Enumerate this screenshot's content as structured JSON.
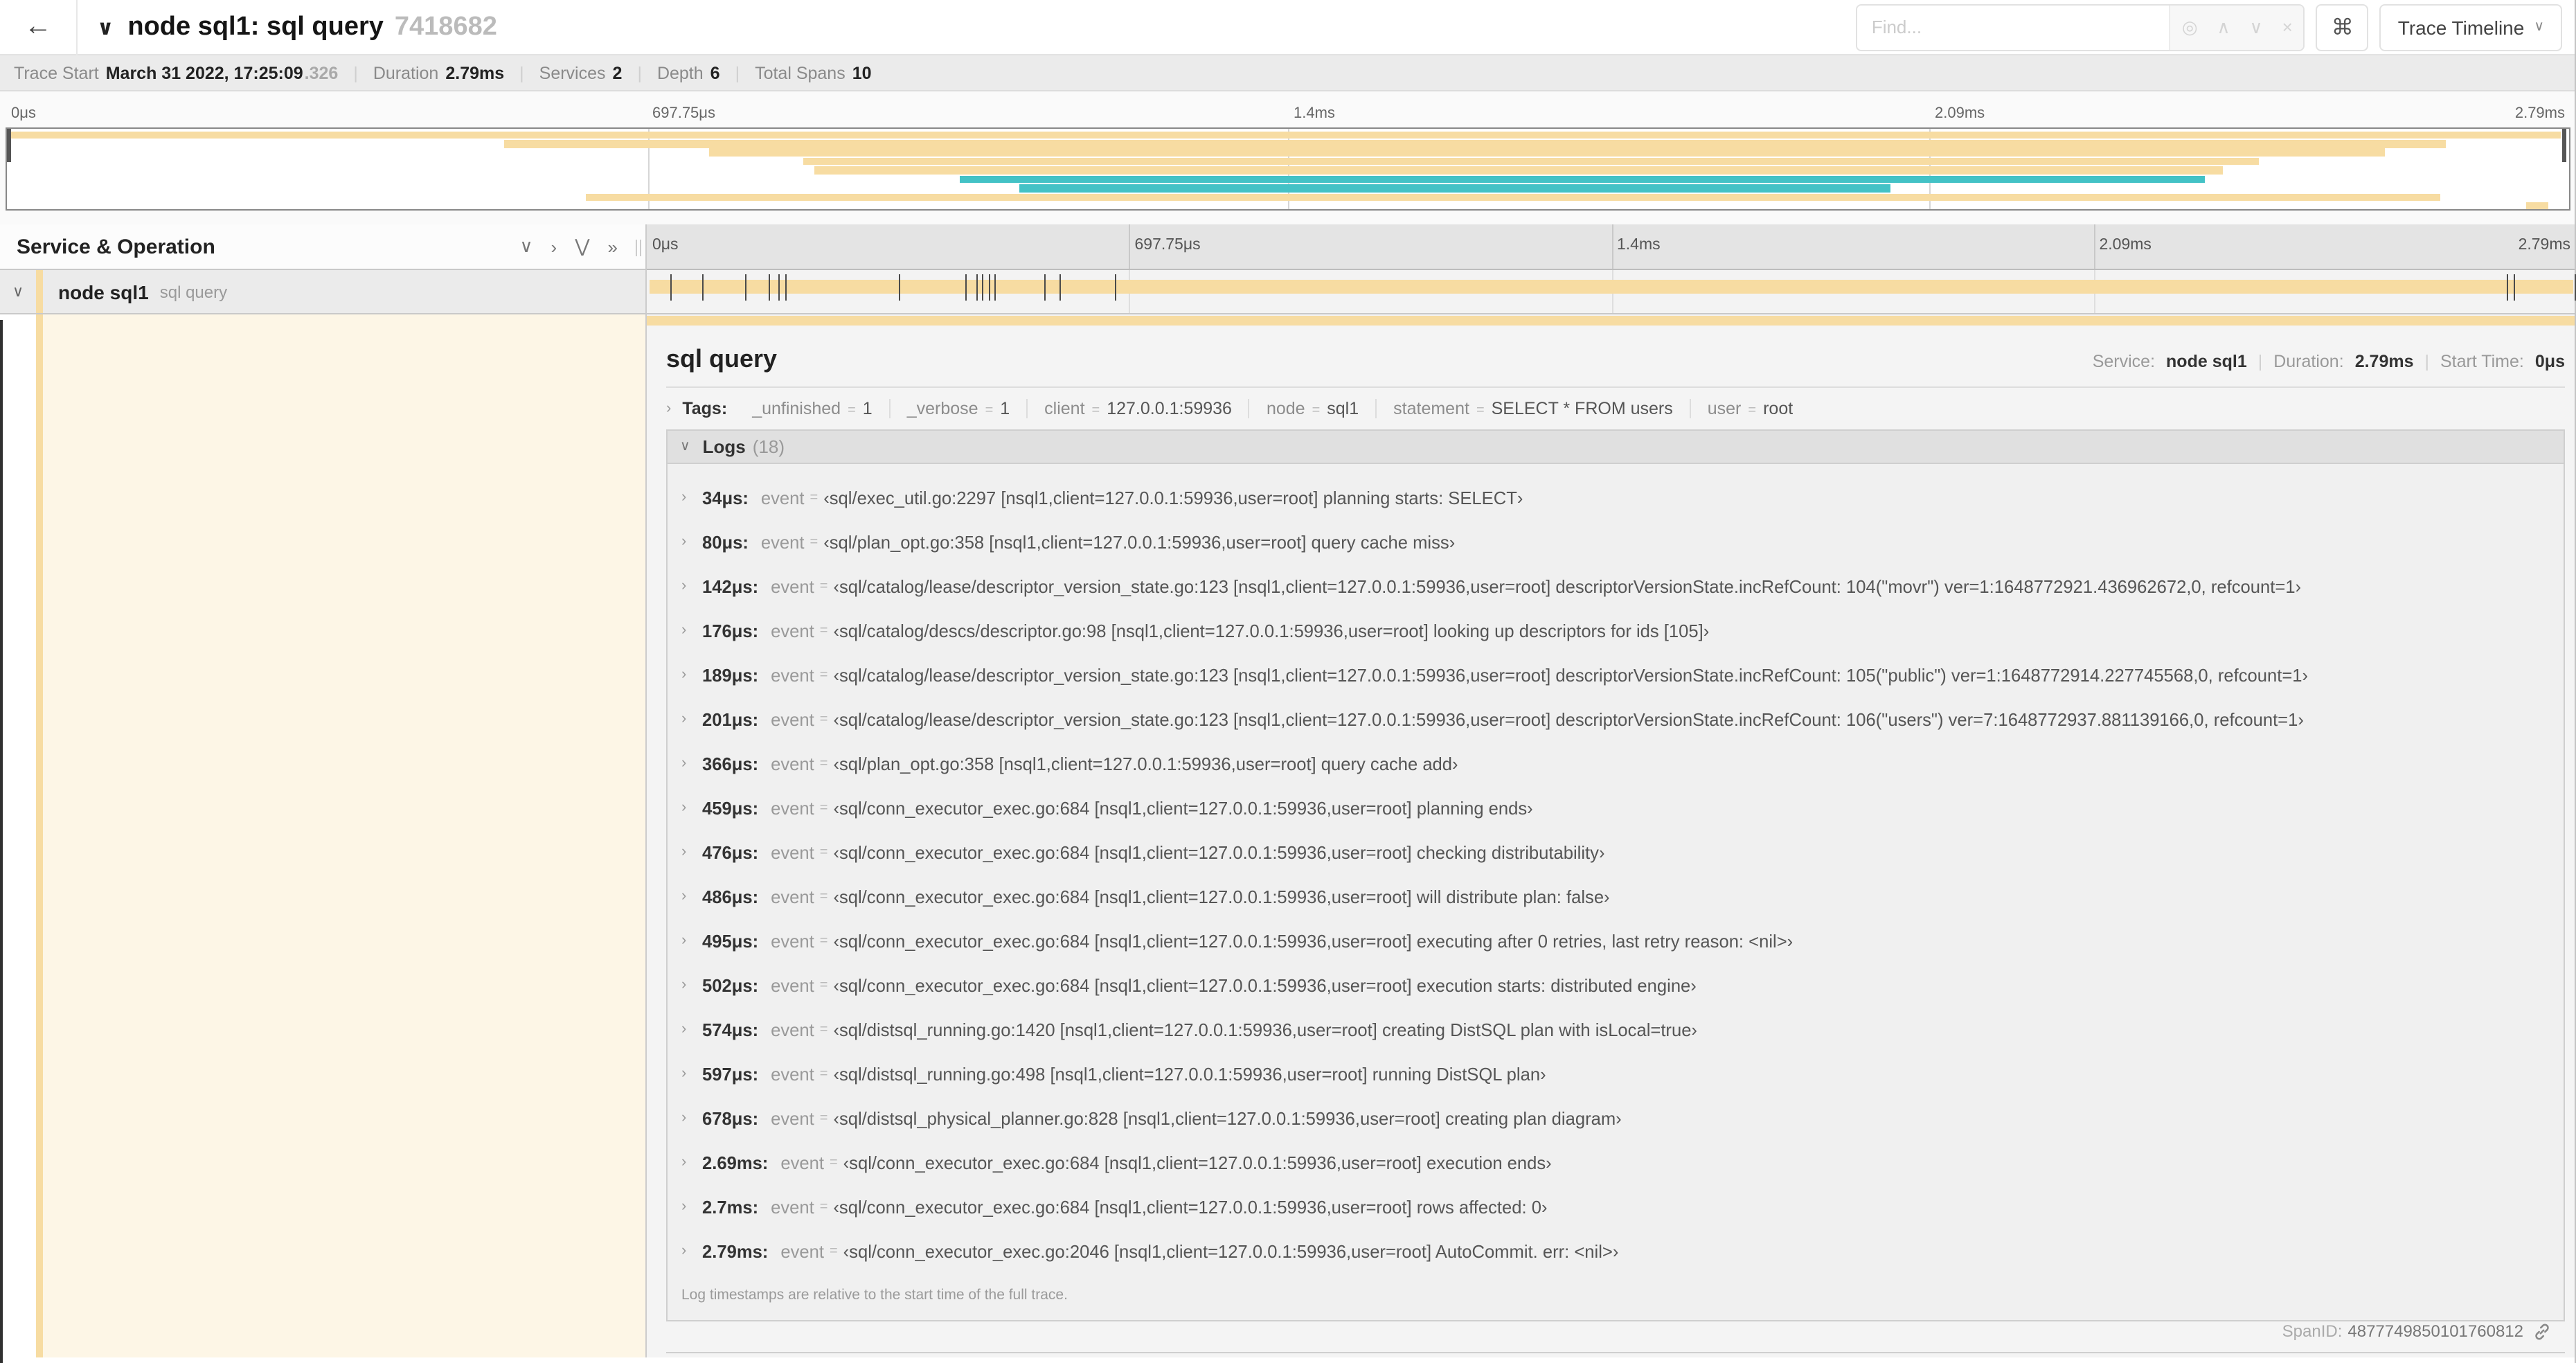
{
  "colors": {
    "orange": "#f7dca2",
    "teal": "#43c2c6",
    "cream": "#fdf6e6"
  },
  "header": {
    "back_icon": "←",
    "collapse_icon": "∨",
    "title": "node sql1: sql query",
    "trace_id_short": "7418682",
    "find_placeholder": "Find...",
    "find_tools": {
      "scope": "◎",
      "prev": "∧",
      "next": "∨",
      "clear": "×"
    },
    "shortcut_icon": "⌘",
    "view_select_label": "Trace Timeline",
    "view_select_caret": "∨"
  },
  "stats": {
    "trace_start_label": "Trace Start",
    "trace_start_value": "March 31 2022, 17:25:09",
    "trace_start_fraction": ".326",
    "duration_label": "Duration",
    "duration_value": "2.79ms",
    "services_label": "Services",
    "services_value": "2",
    "depth_label": "Depth",
    "depth_value": "6",
    "total_spans_label": "Total Spans",
    "total_spans_value": "10"
  },
  "timeline": {
    "ruler_labels": [
      "0μs",
      "697.75μs",
      "1.4ms",
      "2.09ms",
      "2.79ms"
    ],
    "minimap_rows": [
      {
        "color": "orange",
        "start": 0,
        "end": 99.7
      },
      {
        "color": "orange",
        "start": 19.4,
        "end": 95.2
      },
      {
        "color": "orange",
        "start": 27.4,
        "end": 92.8
      },
      {
        "color": "orange",
        "start": 31.1,
        "end": 87.9
      },
      {
        "color": "orange",
        "start": 31.5,
        "end": 86.5
      },
      {
        "color": "teal",
        "start": 37.2,
        "end": 85.8
      },
      {
        "color": "teal",
        "start": 39.5,
        "end": 73.5
      },
      {
        "color": "orange",
        "start": 22.6,
        "end": 95.0
      },
      {
        "color": "orange",
        "start": 98.3,
        "end": 99.2
      }
    ],
    "tick_positions": [
      1.2,
      2.9,
      5.1,
      6.3,
      6.8,
      7.2,
      13.1,
      16.5,
      17.1,
      17.4,
      17.7,
      18.0,
      20.6,
      21.4,
      24.3,
      96.4,
      96.8,
      99.9
    ]
  },
  "columns_header": {
    "title": "Service & Operation",
    "collapse_icons": [
      "∨",
      "›",
      "⋁",
      "»"
    ]
  },
  "span_row": {
    "chevron": "∨",
    "service": "node sql1",
    "operation": "sql query"
  },
  "detail": {
    "title": "sql query",
    "service_label": "Service:",
    "service_value": "node sql1",
    "duration_label": "Duration:",
    "duration_value": "2.79ms",
    "start_label": "Start Time:",
    "start_value": "0μs",
    "tags": {
      "chevron": "›",
      "label": "Tags:",
      "items": [
        {
          "key": "_unfinished",
          "value": "1"
        },
        {
          "key": "_verbose",
          "value": "1"
        },
        {
          "key": "client",
          "value": "127.0.0.1:59936"
        },
        {
          "key": "node",
          "value": "sql1"
        },
        {
          "key": "statement",
          "value": "SELECT * FROM users"
        },
        {
          "key": "user",
          "value": "root"
        }
      ]
    },
    "logs": {
      "chevron": "∨",
      "label": "Logs",
      "count": "(18)",
      "event_key": "event",
      "items": [
        {
          "time": "34μs:",
          "event": "‹sql/exec_util.go:2297 [nsql1,client=127.0.0.1:59936,user=root] planning starts: SELECT›"
        },
        {
          "time": "80μs:",
          "event": "‹sql/plan_opt.go:358 [nsql1,client=127.0.0.1:59936,user=root] query cache miss›"
        },
        {
          "time": "142μs:",
          "event": "‹sql/catalog/lease/descriptor_version_state.go:123 [nsql1,client=127.0.0.1:59936,user=root] descriptorVersionState.incRefCount: 104(\"movr\") ver=1:1648772921.436962672,0, refcount=1›"
        },
        {
          "time": "176μs:",
          "event": "‹sql/catalog/descs/descriptor.go:98 [nsql1,client=127.0.0.1:59936,user=root] looking up descriptors for ids [105]›"
        },
        {
          "time": "189μs:",
          "event": "‹sql/catalog/lease/descriptor_version_state.go:123 [nsql1,client=127.0.0.1:59936,user=root] descriptorVersionState.incRefCount: 105(\"public\") ver=1:1648772914.227745568,0, refcount=1›"
        },
        {
          "time": "201μs:",
          "event": "‹sql/catalog/lease/descriptor_version_state.go:123 [nsql1,client=127.0.0.1:59936,user=root] descriptorVersionState.incRefCount: 106(\"users\") ver=7:1648772937.881139166,0, refcount=1›"
        },
        {
          "time": "366μs:",
          "event": "‹sql/plan_opt.go:358 [nsql1,client=127.0.0.1:59936,user=root] query cache add›"
        },
        {
          "time": "459μs:",
          "event": "‹sql/conn_executor_exec.go:684 [nsql1,client=127.0.0.1:59936,user=root] planning ends›"
        },
        {
          "time": "476μs:",
          "event": "‹sql/conn_executor_exec.go:684 [nsql1,client=127.0.0.1:59936,user=root] checking distributability›"
        },
        {
          "time": "486μs:",
          "event": "‹sql/conn_executor_exec.go:684 [nsql1,client=127.0.0.1:59936,user=root] will distribute plan: false›"
        },
        {
          "time": "495μs:",
          "event": "‹sql/conn_executor_exec.go:684 [nsql1,client=127.0.0.1:59936,user=root] executing after 0 retries, last retry reason: <nil>›"
        },
        {
          "time": "502μs:",
          "event": "‹sql/conn_executor_exec.go:684 [nsql1,client=127.0.0.1:59936,user=root] execution starts: distributed engine›"
        },
        {
          "time": "574μs:",
          "event": "‹sql/distsql_running.go:1420 [nsql1,client=127.0.0.1:59936,user=root] creating DistSQL plan with isLocal=true›"
        },
        {
          "time": "597μs:",
          "event": "‹sql/distsql_running.go:498 [nsql1,client=127.0.0.1:59936,user=root] running DistSQL plan›"
        },
        {
          "time": "678μs:",
          "event": "‹sql/distsql_physical_planner.go:828 [nsql1,client=127.0.0.1:59936,user=root] creating plan diagram›"
        },
        {
          "time": "2.69ms:",
          "event": "‹sql/conn_executor_exec.go:684 [nsql1,client=127.0.0.1:59936,user=root] execution ends›"
        },
        {
          "time": "2.7ms:",
          "event": "‹sql/conn_executor_exec.go:684 [nsql1,client=127.0.0.1:59936,user=root] rows affected: 0›"
        },
        {
          "time": "2.79ms:",
          "event": "‹sql/conn_executor_exec.go:2046 [nsql1,client=127.0.0.1:59936,user=root] AutoCommit. err: <nil>›"
        }
      ],
      "footnote": "Log timestamps are relative to the start time of the full trace."
    },
    "spanid_label": "SpanID:",
    "spanid_value": "4877749850101760812"
  }
}
